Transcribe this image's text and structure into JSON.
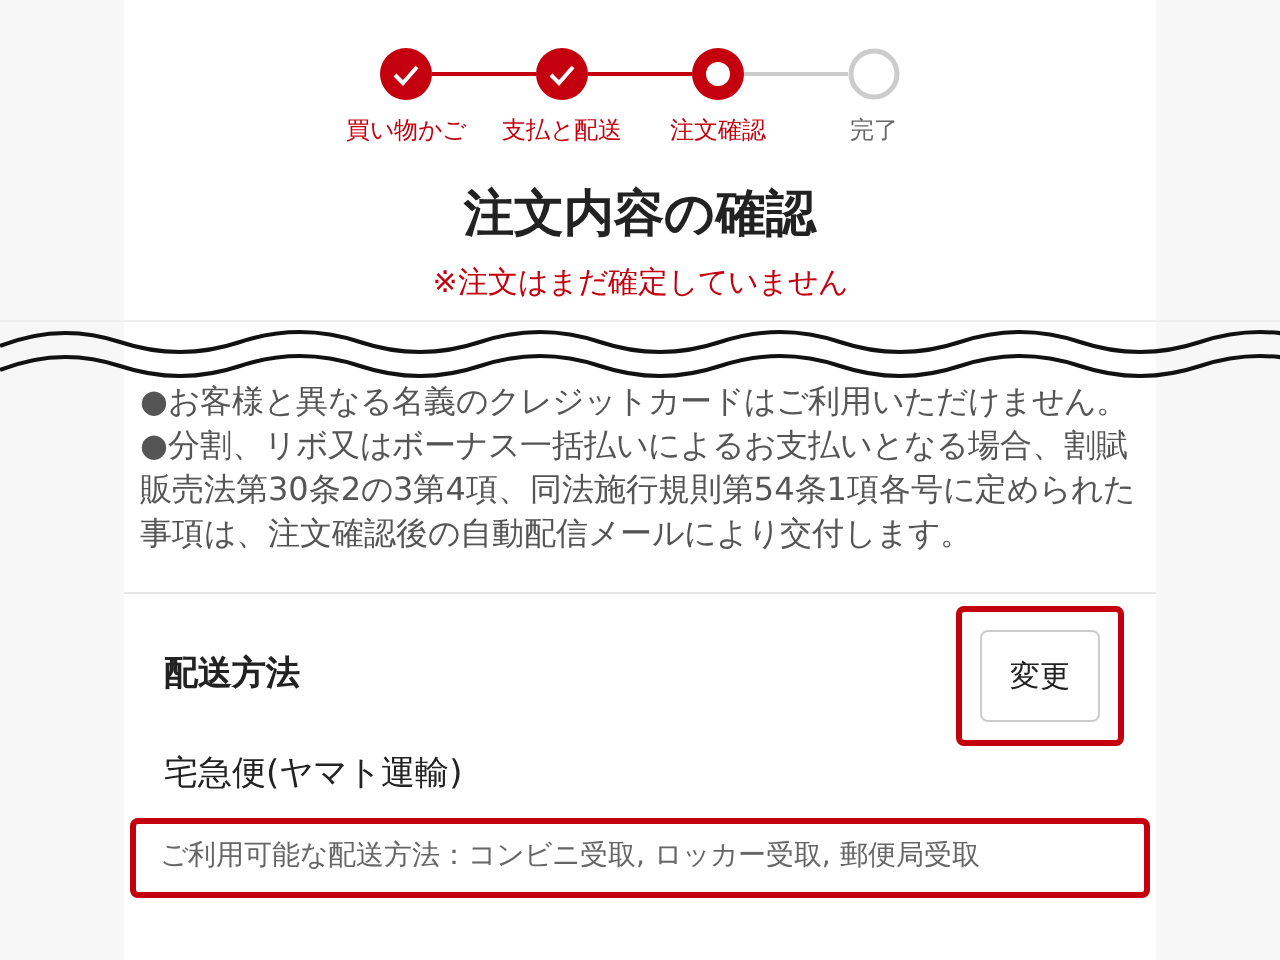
{
  "steps": [
    {
      "label": "買い物かご",
      "kind": "done"
    },
    {
      "label": "支払と配送",
      "kind": "done"
    },
    {
      "label": "注文確認",
      "kind": "current"
    },
    {
      "label": "完了",
      "kind": "todo"
    }
  ],
  "title": "注文内容の確認",
  "notice": "※注文はまだ確定していません",
  "terms": "●お客様と異なる名義のクレジットカードはご利用いただけません。●分割、リボ又はボーナス一括払いによるお支払いとなる場合、割賦販売法第30条2の3第4項、同法施行規則第54条1項各号に定められた事項は、注文確認後の自動配信メールにより交付します。",
  "shipping": {
    "heading": "配送方法",
    "change_button": {
      "label": "変更",
      "highlighted": true
    },
    "method": "宅急便(ヤマト運輸)",
    "note": {
      "text": "ご利用可能な配送方法：コンビニ受取, ロッカー受取, 郵便局受取",
      "highlighted": true
    }
  }
}
